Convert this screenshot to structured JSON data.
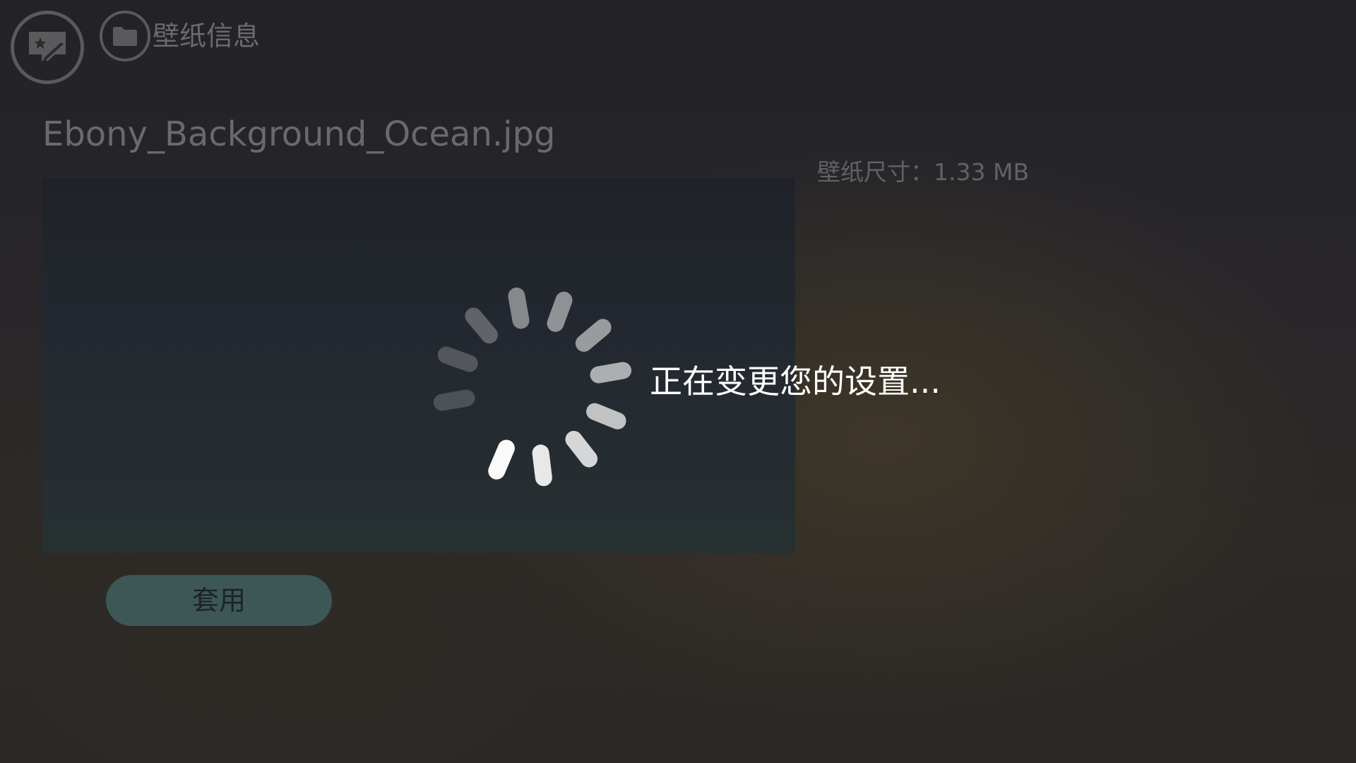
{
  "header": {
    "app_icon": "wallpaper-badge-icon",
    "folder_icon": "folder-icon",
    "title": "壁纸信息"
  },
  "wallpaper": {
    "file_name": "Ebony_Background_Ocean.jpg",
    "size_label": "壁纸尺寸：1.33 MB"
  },
  "actions": {
    "apply_label": "套用"
  },
  "overlay": {
    "loading_text": "正在变更您的设置...",
    "spinner_icon": "loading-spinner-icon"
  },
  "colors": {
    "accent_button": "#3d5757",
    "text_primary": "#ffffff",
    "text_dim": "#6a6a6c"
  }
}
